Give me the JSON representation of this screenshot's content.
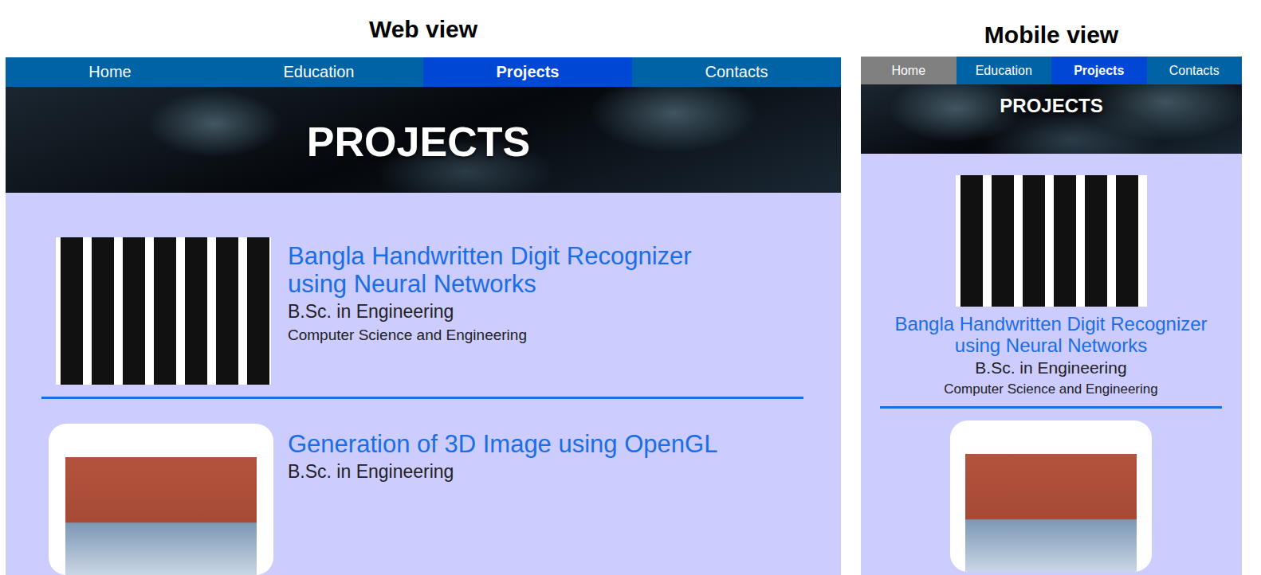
{
  "views": [
    {
      "kind": "web",
      "label": "Web view",
      "nav": [
        {
          "label": "Home",
          "selected": false,
          "hovered": false
        },
        {
          "label": "Education",
          "selected": false,
          "hovered": false
        },
        {
          "label": "Projects",
          "selected": true,
          "hovered": false
        },
        {
          "label": "Contacts",
          "selected": false,
          "hovered": false
        }
      ],
      "hero": {
        "title": "PROJECTS"
      },
      "projects": [
        {
          "kind": "plain",
          "title": "Bangla Handwritten Digit Recognizer using Neural Networks",
          "degree": "B.Sc. in Engineering",
          "department": "Computer Science and Engineering"
        },
        {
          "kind": "card",
          "title": "Generation of 3D Image using OpenGL",
          "degree": "B.Sc. in Engineering"
        }
      ]
    },
    {
      "kind": "mobile",
      "label": "Mobile view",
      "nav": [
        {
          "label": "Home",
          "selected": false,
          "hovered": true
        },
        {
          "label": "Education",
          "selected": false,
          "hovered": false
        },
        {
          "label": "Projects",
          "selected": true,
          "hovered": false
        },
        {
          "label": "Contacts",
          "selected": false,
          "hovered": false
        }
      ],
      "hero": {
        "title": "PROJECTS"
      },
      "projects": [
        {
          "kind": "plain",
          "title": "Bangla Handwritten Digit Recognizer using Neural Networks",
          "degree": "B.Sc. in Engineering",
          "department": "Computer Science and Engineering"
        },
        {
          "kind": "card"
        }
      ]
    }
  ]
}
